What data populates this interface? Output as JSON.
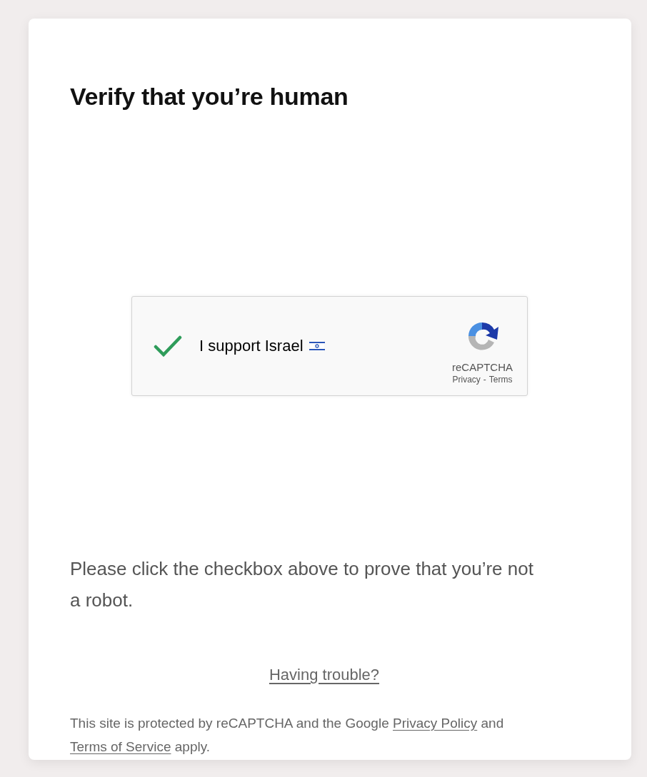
{
  "title": "Verify that you’re human",
  "captcha": {
    "checked": true,
    "label": "I support Israel",
    "brand": "reCAPTCHA",
    "privacy_link": "Privacy",
    "separator": "-",
    "terms_link": "Terms"
  },
  "instructions": "Please click the checkbox above to prove that you’re not a robot.",
  "help_link": "Having trouble?",
  "footer": {
    "text_before": "This site is protected by reCAPTCHA and the Google",
    "privacy_link": "Privacy Policy",
    "text_middle": "and",
    "terms_link": "Terms of Service",
    "text_after": "apply."
  }
}
